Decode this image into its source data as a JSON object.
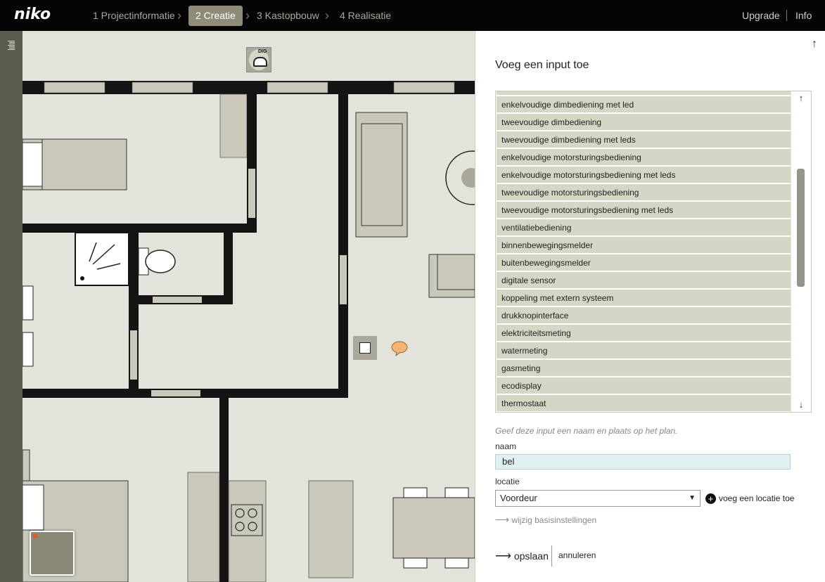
{
  "topbar": {
    "logo": "niko",
    "steps": [
      {
        "label": "1 Projectinformatie"
      },
      {
        "label": "2 Creatie"
      },
      {
        "label": "3 Kastopbouw"
      },
      {
        "label": "4 Realisatie"
      }
    ],
    "upgrade": "Upgrade",
    "info": "Info"
  },
  "plan": {
    "dig_label": "DIG"
  },
  "panel": {
    "title": "Voeg een input toe",
    "list_items": [
      "enkelvoudige dimbediening met led",
      "tweevoudige dimbediening",
      "tweevoudige dimbediening met leds",
      "enkelvoudige motorsturingsbediening",
      "enkelvoudige motorsturingsbediening met leds",
      "tweevoudige motorsturingsbediening",
      "tweevoudige motorsturingsbediening met leds",
      "ventilatiebediening",
      "binnenbewegingsmelder",
      "buitenbewegingsmelder",
      "digitale sensor",
      "koppeling met extern systeem",
      "drukknopinterface",
      "elektriciteitsmeting",
      "watermeting",
      "gasmeting",
      "ecodisplay",
      "thermostaat"
    ],
    "hint": "Geef deze input een naam en plaats op het plan.",
    "name_label": "naam",
    "name_value": "bel",
    "location_label": "locatie",
    "location_value": "Voordeur",
    "add_location": "voeg een locatie toe",
    "advanced": "wijzig basisinstellingen",
    "save": "opslaan",
    "cancel": "annuleren"
  }
}
